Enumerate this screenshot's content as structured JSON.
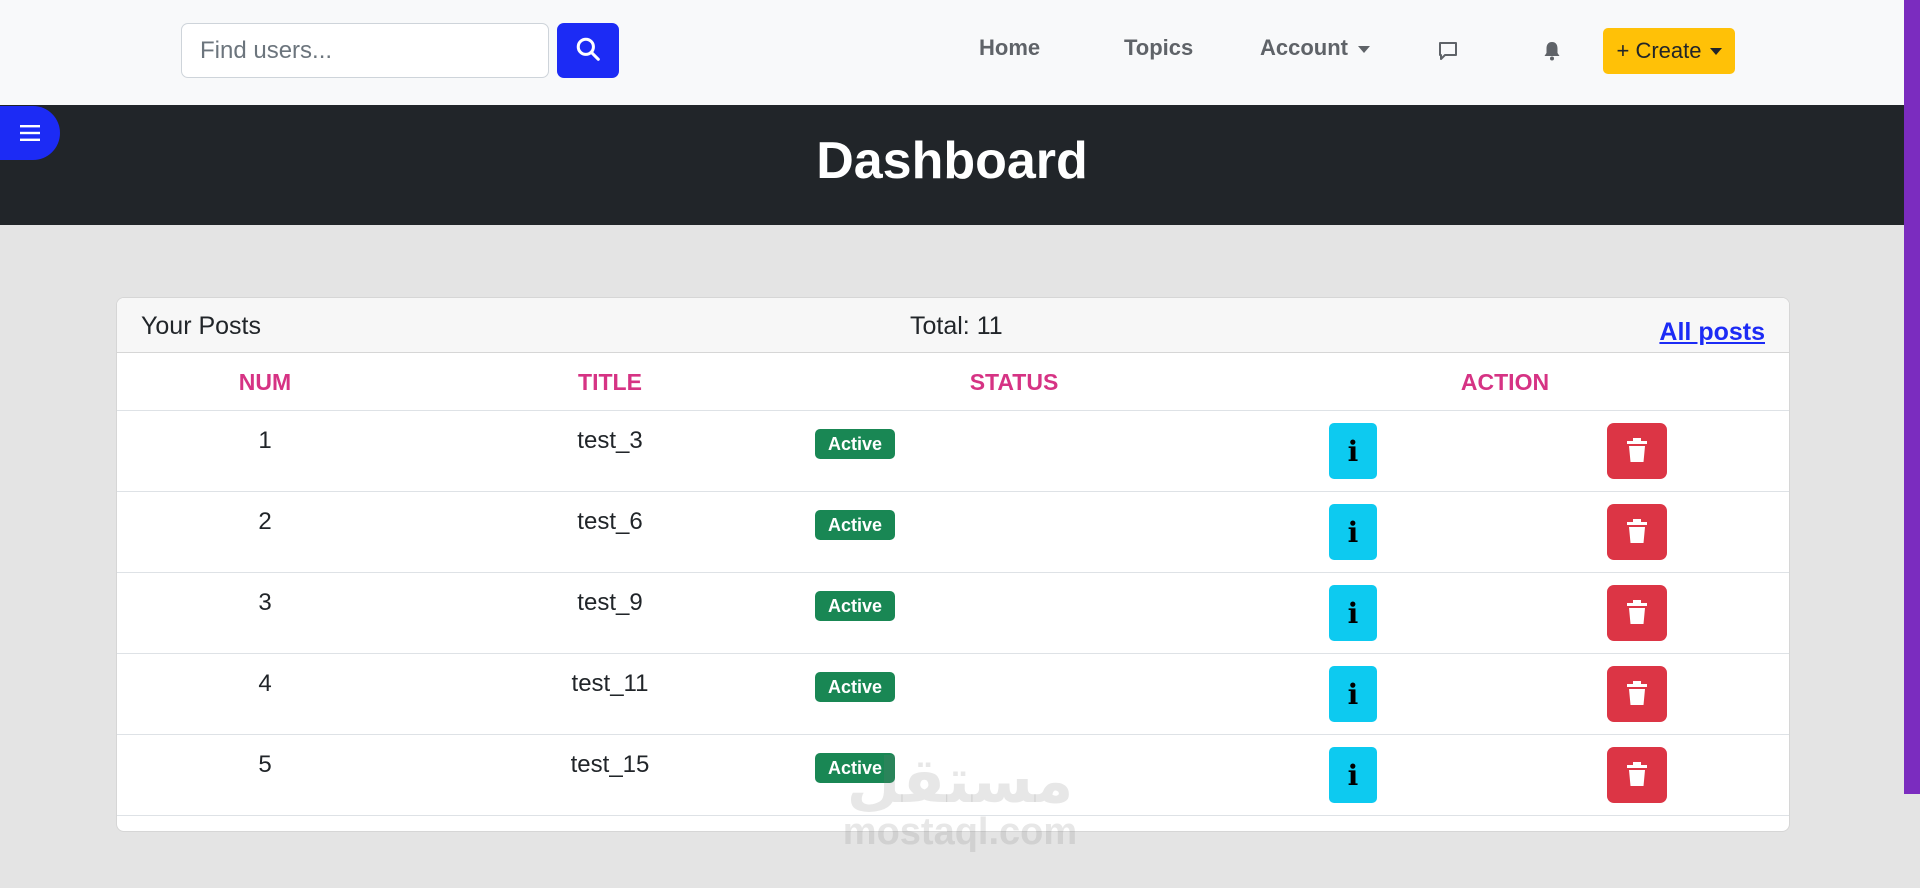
{
  "search": {
    "placeholder": "Find users..."
  },
  "nav": {
    "home": "Home",
    "topics": "Topics",
    "account": "Account",
    "create": "+ Create"
  },
  "banner": {
    "title": "Dashboard"
  },
  "posts": {
    "header_title": "Your Posts",
    "total": "Total: 11",
    "all_posts": "All posts",
    "columns": {
      "num": "NUM",
      "title": "TITLE",
      "status": "STATUS",
      "action": "ACTION"
    },
    "rows": [
      {
        "num": "1",
        "title": "test_3",
        "status": "Active"
      },
      {
        "num": "2",
        "title": "test_6",
        "status": "Active"
      },
      {
        "num": "3",
        "title": "test_9",
        "status": "Active"
      },
      {
        "num": "4",
        "title": "test_11",
        "status": "Active"
      },
      {
        "num": "5",
        "title": "test_15",
        "status": "Active"
      }
    ],
    "info_glyph": "i"
  },
  "watermark": {
    "arabic": "مستقل",
    "latin": "mostaql.com"
  },
  "colors": {
    "brand_blue": "#1c2bf5",
    "create_yellow": "#ffc107",
    "header_dark": "#212529",
    "status_green": "#198754",
    "info_cyan": "#0dcaf0",
    "danger_red": "#dc3545",
    "column_pink": "#d63384"
  },
  "icons": {
    "search": "search-icon",
    "messages": "chat-icon",
    "notifications": "bell-icon",
    "menu": "hamburger-icon",
    "info": "info-icon",
    "delete": "trash-icon"
  }
}
